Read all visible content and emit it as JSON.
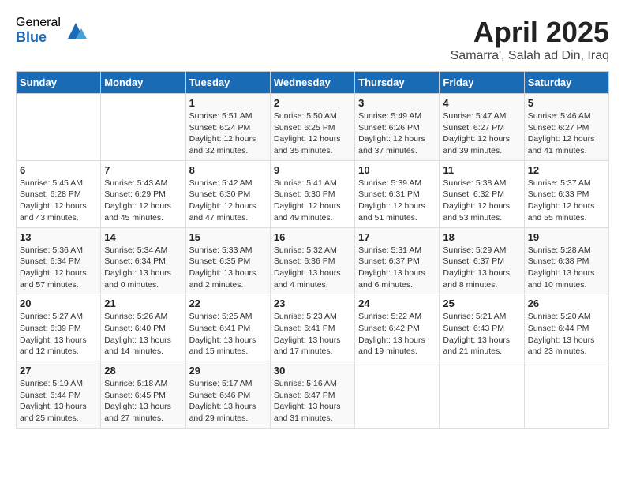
{
  "logo": {
    "general": "General",
    "blue": "Blue"
  },
  "title": "April 2025",
  "location": "Samarra', Salah ad Din, Iraq",
  "days_of_week": [
    "Sunday",
    "Monday",
    "Tuesday",
    "Wednesday",
    "Thursday",
    "Friday",
    "Saturday"
  ],
  "weeks": [
    [
      {
        "day": "",
        "info": ""
      },
      {
        "day": "",
        "info": ""
      },
      {
        "day": "1",
        "info": "Sunrise: 5:51 AM\nSunset: 6:24 PM\nDaylight: 12 hours and 32 minutes."
      },
      {
        "day": "2",
        "info": "Sunrise: 5:50 AM\nSunset: 6:25 PM\nDaylight: 12 hours and 35 minutes."
      },
      {
        "day": "3",
        "info": "Sunrise: 5:49 AM\nSunset: 6:26 PM\nDaylight: 12 hours and 37 minutes."
      },
      {
        "day": "4",
        "info": "Sunrise: 5:47 AM\nSunset: 6:27 PM\nDaylight: 12 hours and 39 minutes."
      },
      {
        "day": "5",
        "info": "Sunrise: 5:46 AM\nSunset: 6:27 PM\nDaylight: 12 hours and 41 minutes."
      }
    ],
    [
      {
        "day": "6",
        "info": "Sunrise: 5:45 AM\nSunset: 6:28 PM\nDaylight: 12 hours and 43 minutes."
      },
      {
        "day": "7",
        "info": "Sunrise: 5:43 AM\nSunset: 6:29 PM\nDaylight: 12 hours and 45 minutes."
      },
      {
        "day": "8",
        "info": "Sunrise: 5:42 AM\nSunset: 6:30 PM\nDaylight: 12 hours and 47 minutes."
      },
      {
        "day": "9",
        "info": "Sunrise: 5:41 AM\nSunset: 6:30 PM\nDaylight: 12 hours and 49 minutes."
      },
      {
        "day": "10",
        "info": "Sunrise: 5:39 AM\nSunset: 6:31 PM\nDaylight: 12 hours and 51 minutes."
      },
      {
        "day": "11",
        "info": "Sunrise: 5:38 AM\nSunset: 6:32 PM\nDaylight: 12 hours and 53 minutes."
      },
      {
        "day": "12",
        "info": "Sunrise: 5:37 AM\nSunset: 6:33 PM\nDaylight: 12 hours and 55 minutes."
      }
    ],
    [
      {
        "day": "13",
        "info": "Sunrise: 5:36 AM\nSunset: 6:34 PM\nDaylight: 12 hours and 57 minutes."
      },
      {
        "day": "14",
        "info": "Sunrise: 5:34 AM\nSunset: 6:34 PM\nDaylight: 13 hours and 0 minutes."
      },
      {
        "day": "15",
        "info": "Sunrise: 5:33 AM\nSunset: 6:35 PM\nDaylight: 13 hours and 2 minutes."
      },
      {
        "day": "16",
        "info": "Sunrise: 5:32 AM\nSunset: 6:36 PM\nDaylight: 13 hours and 4 minutes."
      },
      {
        "day": "17",
        "info": "Sunrise: 5:31 AM\nSunset: 6:37 PM\nDaylight: 13 hours and 6 minutes."
      },
      {
        "day": "18",
        "info": "Sunrise: 5:29 AM\nSunset: 6:37 PM\nDaylight: 13 hours and 8 minutes."
      },
      {
        "day": "19",
        "info": "Sunrise: 5:28 AM\nSunset: 6:38 PM\nDaylight: 13 hours and 10 minutes."
      }
    ],
    [
      {
        "day": "20",
        "info": "Sunrise: 5:27 AM\nSunset: 6:39 PM\nDaylight: 13 hours and 12 minutes."
      },
      {
        "day": "21",
        "info": "Sunrise: 5:26 AM\nSunset: 6:40 PM\nDaylight: 13 hours and 14 minutes."
      },
      {
        "day": "22",
        "info": "Sunrise: 5:25 AM\nSunset: 6:41 PM\nDaylight: 13 hours and 15 minutes."
      },
      {
        "day": "23",
        "info": "Sunrise: 5:23 AM\nSunset: 6:41 PM\nDaylight: 13 hours and 17 minutes."
      },
      {
        "day": "24",
        "info": "Sunrise: 5:22 AM\nSunset: 6:42 PM\nDaylight: 13 hours and 19 minutes."
      },
      {
        "day": "25",
        "info": "Sunrise: 5:21 AM\nSunset: 6:43 PM\nDaylight: 13 hours and 21 minutes."
      },
      {
        "day": "26",
        "info": "Sunrise: 5:20 AM\nSunset: 6:44 PM\nDaylight: 13 hours and 23 minutes."
      }
    ],
    [
      {
        "day": "27",
        "info": "Sunrise: 5:19 AM\nSunset: 6:44 PM\nDaylight: 13 hours and 25 minutes."
      },
      {
        "day": "28",
        "info": "Sunrise: 5:18 AM\nSunset: 6:45 PM\nDaylight: 13 hours and 27 minutes."
      },
      {
        "day": "29",
        "info": "Sunrise: 5:17 AM\nSunset: 6:46 PM\nDaylight: 13 hours and 29 minutes."
      },
      {
        "day": "30",
        "info": "Sunrise: 5:16 AM\nSunset: 6:47 PM\nDaylight: 13 hours and 31 minutes."
      },
      {
        "day": "",
        "info": ""
      },
      {
        "day": "",
        "info": ""
      },
      {
        "day": "",
        "info": ""
      }
    ]
  ]
}
